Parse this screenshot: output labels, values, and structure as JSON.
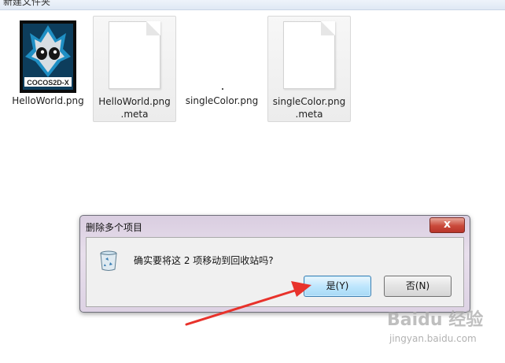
{
  "window": {
    "folder_title": "新建文件夹"
  },
  "files": [
    {
      "name_line1": "HelloWorld.png",
      "name_line2": "",
      "icon": "cocos2d-x-image-icon",
      "selected": false
    },
    {
      "name_line1": "HelloWorld.png",
      "name_line2": ".meta",
      "icon": "blank-document-icon",
      "selected": true
    },
    {
      "name_line1": "singleColor.png",
      "name_line2": "",
      "icon": "tiny-image-icon",
      "selected": false
    },
    {
      "name_line1": "singleColor.png",
      "name_line2": ".meta",
      "icon": "blank-document-icon",
      "selected": true
    }
  ],
  "icon_text": {
    "cocos_logo": "COCOS2D-X"
  },
  "dialog": {
    "title": "删除多个项目",
    "close_label": "x",
    "message": "确实要将这 2 项移动到回收站吗?",
    "yes_label": "是(Y)",
    "no_label": "否(N)"
  },
  "watermark": {
    "brand": "Baidu 经验",
    "url": "jingyan.baidu.com"
  },
  "colors": {
    "annotation_arrow": "#e8322b",
    "dialog_frame": "#d9cde0",
    "default_button": "#bee6fd"
  }
}
